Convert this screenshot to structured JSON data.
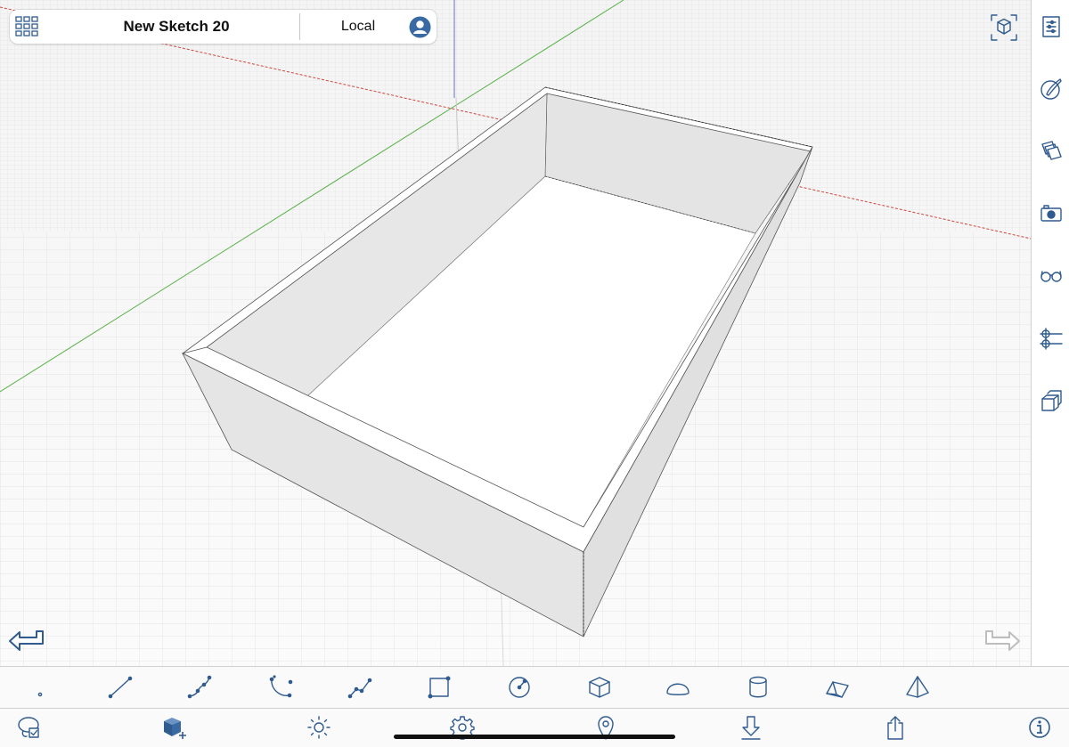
{
  "app": {
    "document_title": "New Sketch 20",
    "location_label": "Local"
  },
  "colors": {
    "accent": "#2f5b8f",
    "accent_fill": "#3a6aa3",
    "red_axis": "#d0463d",
    "green_axis": "#58b048",
    "blue_axis": "#6a6ad0",
    "face": "#e6e6e6",
    "background": "#fbfbfb"
  },
  "header_icons": {
    "menu": "grid-icon",
    "profile": "user-icon"
  },
  "sidebar_icons": [
    "entity-info-icon",
    "materials-icon",
    "layers-icon",
    "scenes-icon",
    "styles-icon",
    "section-planes-icon",
    "components-icon"
  ],
  "view_icons": {
    "view_cube": "view-cube-icon",
    "undo": "undo-arrow-icon",
    "redo": "redo-arrow-icon"
  },
  "draw_tools": [
    "point-tool-icon",
    "line-tool-icon",
    "freehand-tool-icon",
    "arc-tool-icon",
    "polyline-tool-icon",
    "rectangle-tool-icon",
    "circle-tool-icon",
    "box-tool-icon",
    "hemisphere-tool-icon",
    "cylinder-tool-icon",
    "prism-tool-icon",
    "pyramid-tool-icon"
  ],
  "actions": [
    "select-lasso-icon",
    "add-component-icon",
    "shadows-icon",
    "settings-gear-icon",
    "geolocation-pin-icon",
    "download-icon",
    "share-icon",
    "info-icon"
  ]
}
